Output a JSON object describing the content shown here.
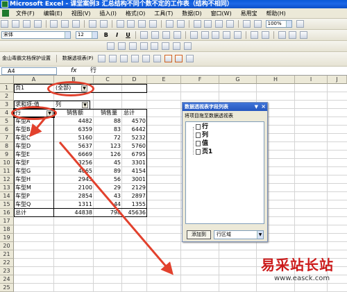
{
  "window": {
    "title": "Microsoft Excel - 课堂案例3  汇总结构不同个数不定的工作表（结构不相同）"
  },
  "menu": [
    "文件(F)",
    "编辑(E)",
    "视图(V)",
    "插入(I)",
    "格式(O)",
    "工具(T)",
    "数据(D)",
    "窗口(W)",
    "易用宝",
    "帮助(H)"
  ],
  "toolbar": {
    "zoom": "100%",
    "font_name": "宋体",
    "font_size": "12",
    "bold": "B",
    "italic": "I",
    "underline": "U"
  },
  "toolbar3": {
    "addin_label": "金山毒霸文档保护设置",
    "pivot_menu": "数据透视表(P)"
  },
  "formula_bar": {
    "name_box": "A4",
    "fx": "fx",
    "value": "行"
  },
  "columns": [
    "A",
    "B",
    "C",
    "D",
    "E",
    "F",
    "G",
    "H",
    "I",
    "J"
  ],
  "rows": [
    "1",
    "2",
    "3",
    "4",
    "5",
    "6",
    "7",
    "8",
    "9",
    "10",
    "11",
    "12",
    "13",
    "14",
    "15",
    "16",
    "17",
    "18",
    "19",
    "20",
    "21",
    "22",
    "23",
    "24",
    "25"
  ],
  "pivot": {
    "page_field": "页1",
    "page_value": "(全部)",
    "data_caption": "求和项:值",
    "col_field": "列",
    "row_field": "行",
    "headers": [
      "销售额",
      "销售量",
      "总计"
    ],
    "rows": [
      {
        "label": "车型A",
        "values": [
          "4482",
          "88",
          "4570"
        ]
      },
      {
        "label": "车型B",
        "values": [
          "6359",
          "83",
          "6442"
        ]
      },
      {
        "label": "车型C",
        "values": [
          "5160",
          "72",
          "5232"
        ]
      },
      {
        "label": "车型D",
        "values": [
          "5637",
          "123",
          "5760"
        ]
      },
      {
        "label": "车型E",
        "values": [
          "6669",
          "126",
          "6795"
        ]
      },
      {
        "label": "车型F",
        "values": [
          "3256",
          "45",
          "3301"
        ]
      },
      {
        "label": "车型G",
        "values": [
          "4065",
          "89",
          "4154"
        ]
      },
      {
        "label": "车型H",
        "values": [
          "2945",
          "56",
          "3001"
        ]
      },
      {
        "label": "车型M",
        "values": [
          "2100",
          "29",
          "2129"
        ]
      },
      {
        "label": "车型P",
        "values": [
          "2854",
          "43",
          "2897"
        ]
      },
      {
        "label": "车型Q",
        "values": [
          "1311",
          "44",
          "1355"
        ]
      }
    ],
    "total": {
      "label": "总计",
      "values": [
        "44838",
        "798",
        "45636"
      ]
    }
  },
  "field_pane": {
    "title": "数据透视表字段列表",
    "hint": "将项目拖至数据透视表",
    "fields": [
      "行",
      "列",
      "值",
      "页1"
    ],
    "add_button": "添加到",
    "area_select": "行区域"
  },
  "watermark": {
    "brand": "易采站长站",
    "url": "www.easck.com"
  },
  "annotation_color": "#e2412d"
}
